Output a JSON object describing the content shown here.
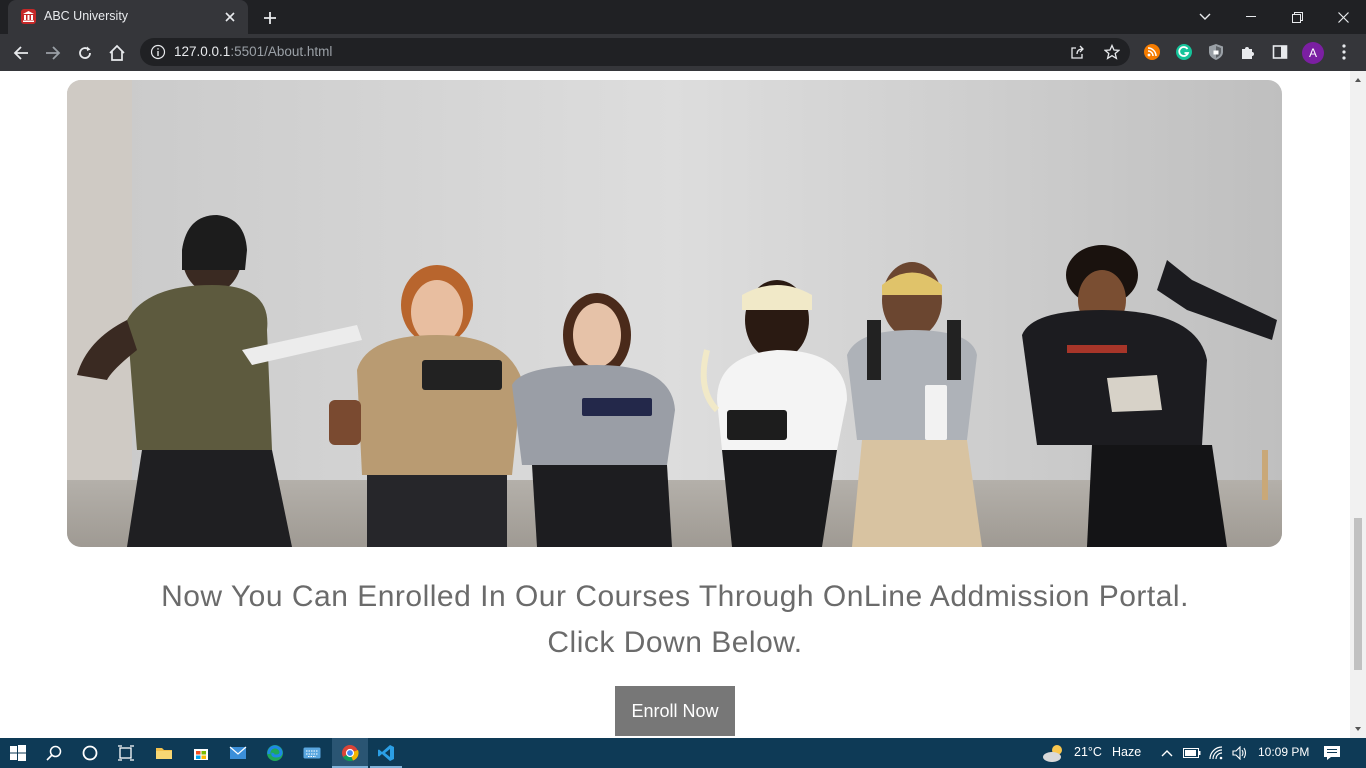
{
  "browser": {
    "tab_title": "ABC University",
    "url_host": "127.0.0.1",
    "url_rest": ":5501/About.html",
    "profile_initial": "A"
  },
  "page": {
    "hero_alt": "",
    "headline_line1": "Now You Can Enrolled In Our Courses Through OnLine Addmission Portal.",
    "headline_line2": "Click Down Below.",
    "enroll_label": "Enroll Now"
  },
  "taskbar": {
    "weather_temp": "21°C",
    "weather_desc": "Haze",
    "time": "10:09 PM"
  },
  "icons": {
    "tab": [
      "university-favicon-icon",
      "close-icon",
      "plus-icon"
    ],
    "window": [
      "chevron-down-icon",
      "minimize-icon",
      "restore-icon",
      "close-icon"
    ],
    "toolbar": [
      "back-icon",
      "forward-icon",
      "reload-icon",
      "home-icon",
      "info-icon",
      "share-icon",
      "star-icon",
      "rss-extension-icon",
      "grammarly-icon",
      "shield-extension-icon",
      "puzzle-icon",
      "sidebar-icon",
      "kebab-menu-icon"
    ],
    "taskbar": [
      "windows-start-icon",
      "search-icon",
      "cortana-icon",
      "task-view-icon",
      "file-explorer-icon",
      "store-icon",
      "mail-icon",
      "edge-icon",
      "keyboard-icon",
      "chrome-icon",
      "vscode-icon",
      "weather-icon",
      "chevron-up-icon",
      "battery-icon",
      "wifi-icon",
      "volume-icon",
      "notification-icon"
    ]
  },
  "colors": {
    "chrome_dark": "#202124",
    "chrome_toolbar": "#35363a",
    "headline": "#6b6b6b",
    "button_bg": "#777777",
    "taskbar": "#0e3a56"
  }
}
